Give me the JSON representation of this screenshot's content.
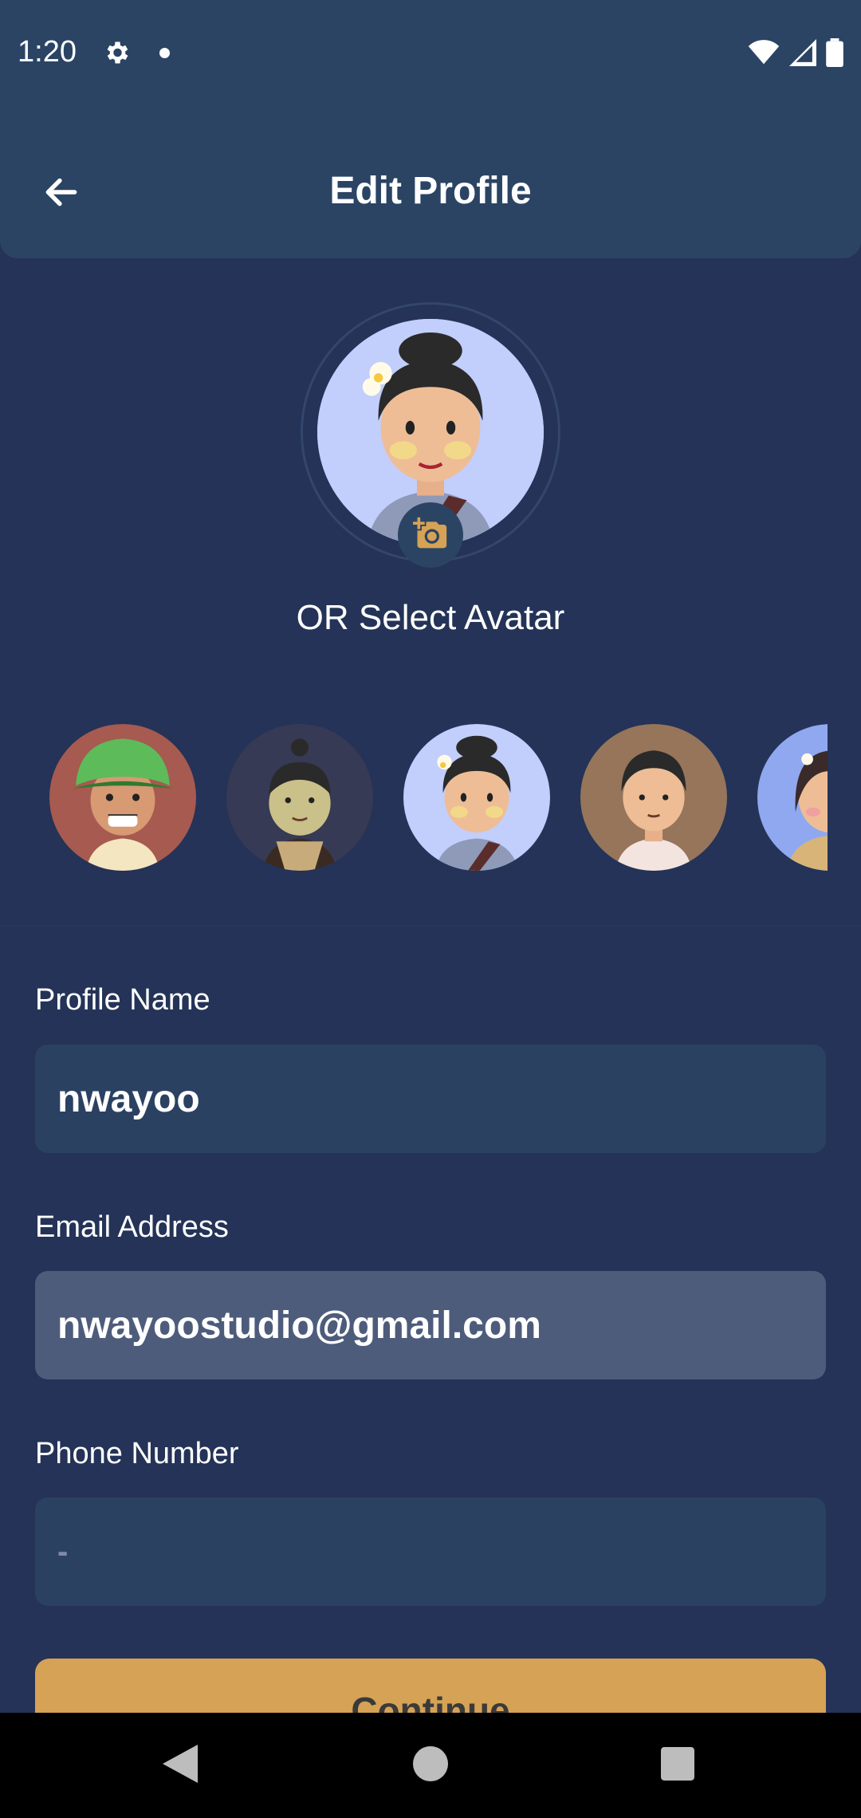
{
  "status_bar": {
    "time": "1:20",
    "icons": [
      "gear-icon",
      "notification-dot",
      "wifi-icon",
      "cellular-icon",
      "battery-icon"
    ]
  },
  "app_bar": {
    "title": "Edit Profile",
    "back_icon": "arrow-left-icon"
  },
  "avatar_section": {
    "upload_icon": "add-camera-icon",
    "select_label": "OR Select Avatar",
    "avatars": [
      {
        "name": "avatar-boy-green-hat",
        "bg": "#a65a50"
      },
      {
        "name": "avatar-boy-topknot",
        "bg": "#363a54"
      },
      {
        "name": "avatar-girl-flower",
        "bg": "#c2cefc"
      },
      {
        "name": "avatar-boy-shirt",
        "bg": "#96755a"
      },
      {
        "name": "avatar-girl-partial",
        "bg": "#90a8f0"
      }
    ]
  },
  "form": {
    "profile_name": {
      "label": "Profile Name",
      "value": "nwayoo"
    },
    "email": {
      "label": "Email Address",
      "value": "nwayoostudio@gmail.com"
    },
    "phone": {
      "label": "Phone Number",
      "value": "-"
    }
  },
  "continue_button": {
    "label": "Continue"
  },
  "colors": {
    "background": "#243357",
    "app_bar": "#2b4464",
    "input": "#2b4162",
    "input_disabled": "#4e5c7c",
    "accent": "#d6a255"
  }
}
